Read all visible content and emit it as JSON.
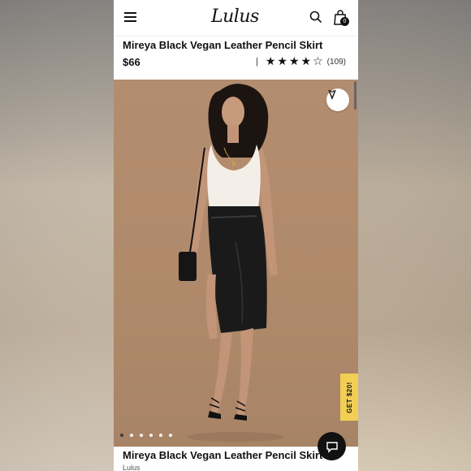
{
  "app": {
    "logo": "Lulus"
  },
  "header": {
    "bag_count": "0"
  },
  "product": {
    "title": "Mireya Black Vegan Leather Pencil Skirt",
    "price": "$66",
    "rating": 4,
    "rating_max": 5,
    "review_count": "(109)",
    "brand": "Lulus"
  },
  "gallery": {
    "image_count": 6,
    "active_index": 0
  },
  "promo": {
    "label": "GET $20!"
  },
  "icons": {
    "menu": "hamburger-icon",
    "search": "search-icon",
    "bag": "shopping-bag-icon",
    "wishlist": "heart-icon",
    "chat": "chat-icon"
  },
  "colors": {
    "accent": "#f2cf54",
    "dark": "#111111"
  }
}
